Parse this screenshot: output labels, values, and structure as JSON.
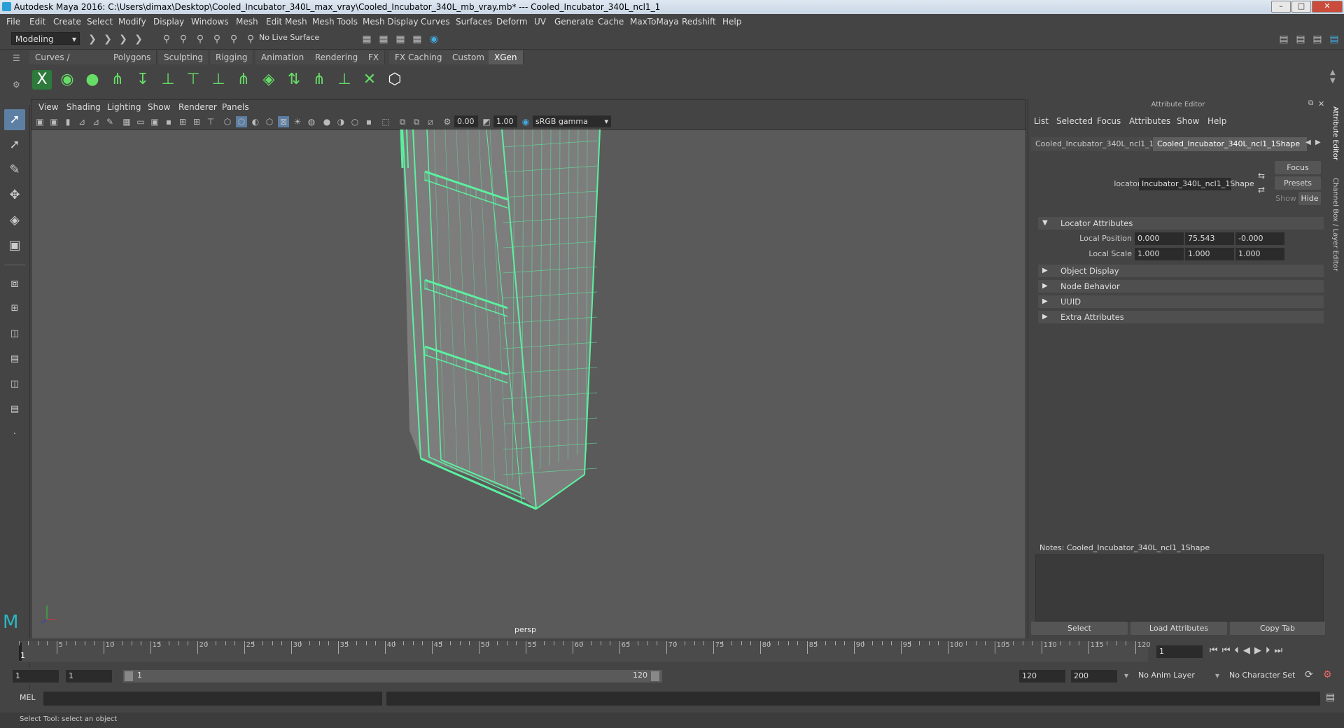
{
  "window": {
    "title": "Autodesk Maya 2016: C:\\Users\\dimax\\Desktop\\Cooled_Incubator_340L_max_vray\\Cooled_Incubator_340L_mb_vray.mb*   ---   Cooled_Incubator_340L_ncl1_1"
  },
  "menubar": [
    "File",
    "Edit",
    "Create",
    "Select",
    "Modify",
    "Display",
    "Windows",
    "Mesh",
    "Edit Mesh",
    "Mesh Tools",
    "Mesh Display",
    "Curves",
    "Surfaces",
    "Deform",
    "UV",
    "Generate",
    "Cache",
    "MaxToMaya",
    "Redshift",
    "Help"
  ],
  "status": {
    "mode": "Modeling",
    "live_surface": "No Live Surface"
  },
  "shelf_tabs": [
    "Curves / Surfaces",
    "Polygons",
    "Sculpting",
    "Rigging",
    "Animation",
    "Rendering",
    "FX",
    "FX Caching",
    "Custom",
    "XGen"
  ],
  "shelf_active": "XGen",
  "viewport": {
    "menu": [
      "View",
      "Shading",
      "Lighting",
      "Show",
      "Renderer",
      "Panels"
    ],
    "exposure": "0.00",
    "gamma": "1.00",
    "color_space": "sRGB gamma",
    "camera_label": "persp",
    "wire_color": "#5cf0a0"
  },
  "attribute_editor": {
    "title": "Attribute Editor",
    "menu": [
      "List",
      "Selected",
      "Focus",
      "Attributes",
      "Show",
      "Help"
    ],
    "tabs": [
      "Cooled_Incubator_340L_ncl1_1",
      "Cooled_Incubator_340L_ncl1_1Shape"
    ],
    "locator_label": "locator:",
    "locator_value": "Incubator_340L_ncl1_1Shape",
    "buttons": {
      "focus": "Focus",
      "presets": "Presets",
      "show": "Show",
      "hide": "Hide"
    },
    "sections": [
      {
        "label": "Locator Attributes",
        "expanded": true
      },
      {
        "label": "Object Display",
        "expanded": false
      },
      {
        "label": "Node Behavior",
        "expanded": false
      },
      {
        "label": "UUID",
        "expanded": false
      },
      {
        "label": "Extra Attributes",
        "expanded": false
      }
    ],
    "local_position": {
      "label": "Local Position",
      "x": "0.000",
      "y": "75.543",
      "z": "-0.000"
    },
    "local_scale": {
      "label": "Local Scale",
      "x": "1.000",
      "y": "1.000",
      "z": "1.000"
    },
    "notes_label": "Notes:  Cooled_Incubator_340L_ncl1_1Shape",
    "bottom_buttons": [
      "Select",
      "Load Attributes",
      "Copy Tab"
    ]
  },
  "side_tabs": [
    "Attribute Editor",
    "Channel Box / Layer Editor"
  ],
  "timeline": {
    "ticks": [
      "5",
      "10",
      "15",
      "20",
      "25",
      "30",
      "35",
      "40",
      "45",
      "50",
      "55",
      "60",
      "65",
      "70",
      "75",
      "80",
      "85",
      "90",
      "95",
      "100",
      "105",
      "110",
      "115",
      "120"
    ],
    "current_frame_marker": "1",
    "current_frame_field": "1"
  },
  "range": {
    "start": "1",
    "playback_start": "1",
    "slider_start": "1",
    "slider_end": "120",
    "playback_end": "120",
    "end": "200",
    "anim_layer": "No Anim Layer",
    "char_set": "No Character Set"
  },
  "command_line": {
    "label": "MEL"
  },
  "help_line": "Select Tool: select an object"
}
